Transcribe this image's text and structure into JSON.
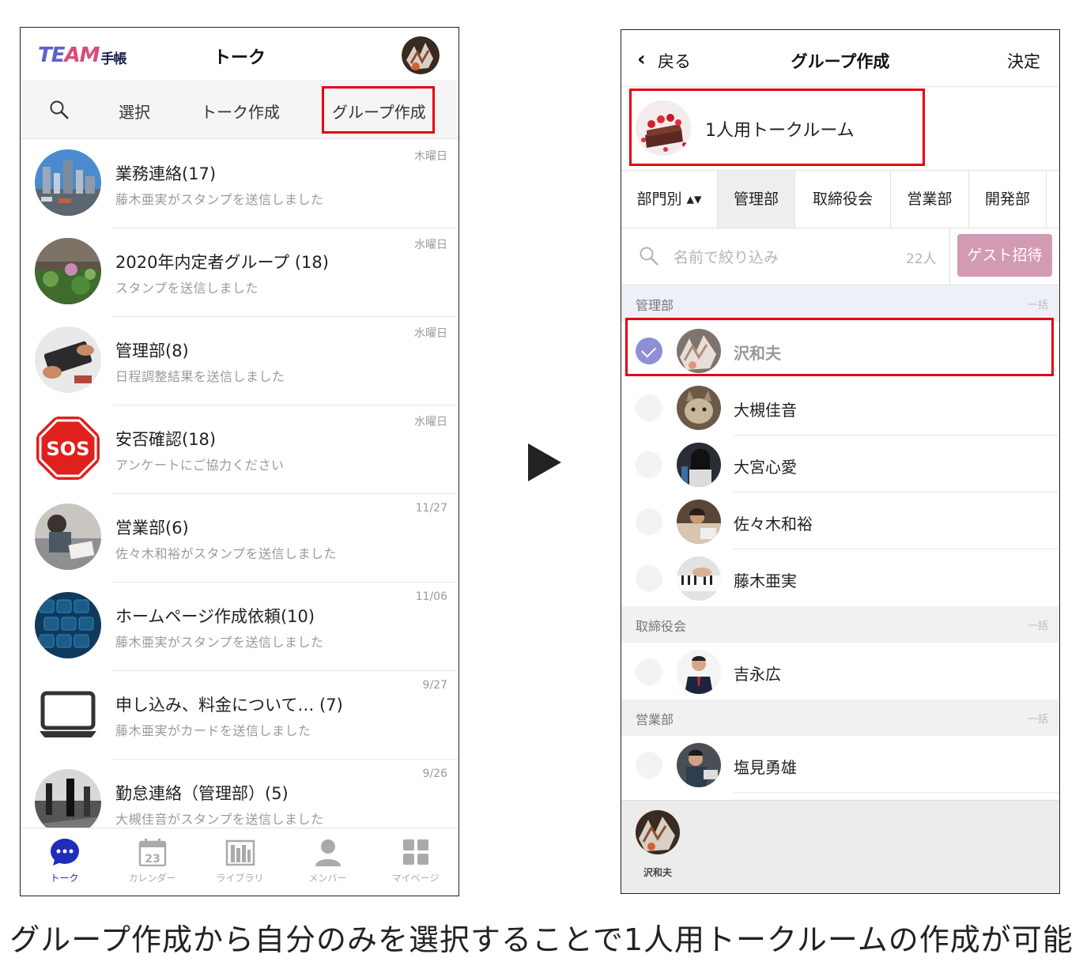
{
  "left": {
    "logo": {
      "team_a": "TE",
      "team_b": "AM",
      "techo": "手帳"
    },
    "title": "トーク",
    "toolbar": {
      "select": "選択",
      "create_talk": "トーク作成",
      "create_group": "グループ作成"
    },
    "talks": [
      {
        "title": "業務連絡(17)",
        "sub": "藤木亜実がスタンプを送信しました",
        "date": "木曜日"
      },
      {
        "title": "2020年内定者グループ (18)",
        "sub": "スタンプを送信しました",
        "date": "水曜日"
      },
      {
        "title": "管理部(8)",
        "sub": "日程調整結果を送信しました",
        "date": "水曜日"
      },
      {
        "title": "安否確認(18)",
        "sub": "アンケートにご協力ください",
        "date": "水曜日",
        "badge": "SOS"
      },
      {
        "title": "営業部(6)",
        "sub": "佐々木和裕がスタンプを送信しました",
        "date": "11/27"
      },
      {
        "title": "ホームページ作成依頼(10)",
        "sub": "藤木亜実がスタンプを送信しました",
        "date": "11/06"
      },
      {
        "title": "申し込み、料金について… (7)",
        "sub": "藤木亜実がカードを送信しました",
        "date": "9/27"
      },
      {
        "title": "勤怠連絡（管理部）(5)",
        "sub": "大槻佳音がスタンプを送信しました",
        "date": "9/26"
      }
    ],
    "tabs": {
      "talk": "トーク",
      "calendar": "カレンダー",
      "calendar_day": "23",
      "library": "ライブラリ",
      "member": "メンバー",
      "mypage": "マイページ"
    },
    "colors": {
      "active": "#1f2dbb",
      "highlight": "#e60012"
    }
  },
  "right": {
    "back": "戻る",
    "title": "グループ作成",
    "confirm": "決定",
    "room_name": "1人用トークルーム",
    "dept_tabs": {
      "by_dept": "部門別 ▴▾",
      "admin": "管理部",
      "board": "取締役会",
      "sales": "営業部",
      "dev": "開発部"
    },
    "search": {
      "placeholder": "名前で絞り込み",
      "count": "22人",
      "guest": "ゲスト招待"
    },
    "sections": {
      "admin": {
        "name": "管理部",
        "all": "一括"
      },
      "board": {
        "name": "取締役会",
        "all": "一括"
      },
      "sales": {
        "name": "営業部",
        "all": "一括"
      }
    },
    "members": {
      "m1": "沢和夫",
      "m2": "大槻佳音",
      "m3": "大宮心愛",
      "m4": "佐々木和裕",
      "m5": "藤木亜実",
      "m6": "吉永広",
      "m7": "塩見勇雄"
    },
    "tray_name": "沢和夫"
  },
  "caption": "グループ作成から自分のみを選択することで1人用トークルームの作成が可能"
}
